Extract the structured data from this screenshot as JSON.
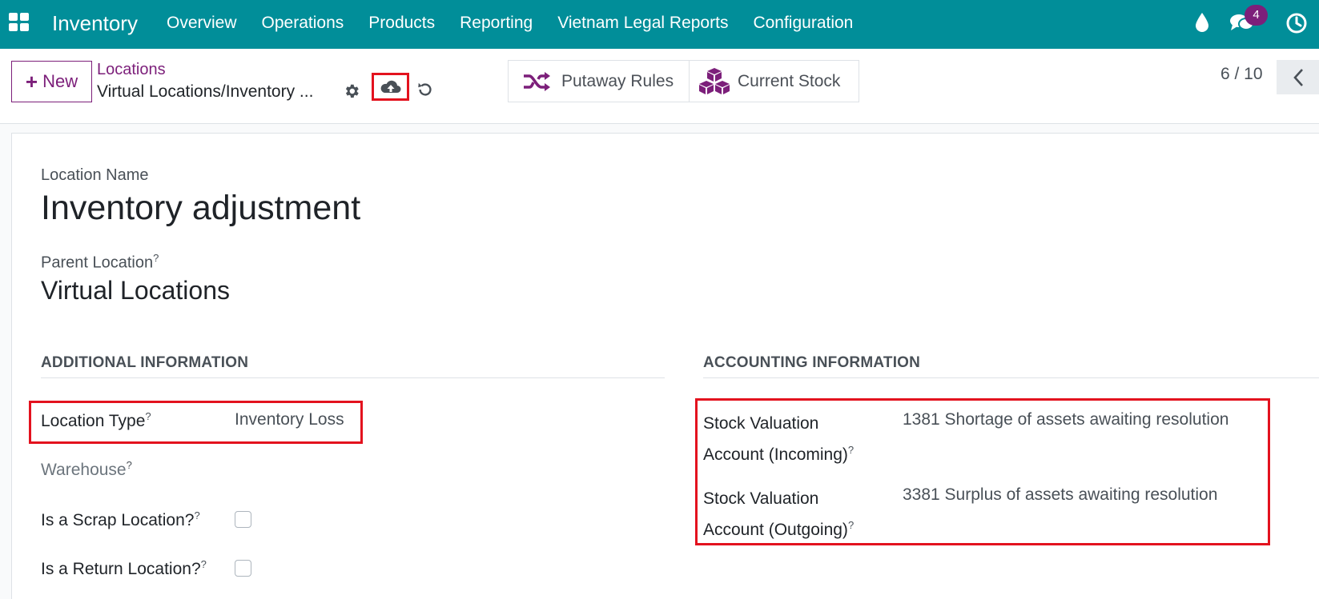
{
  "navbar": {
    "app_name": "Inventory",
    "menu": [
      "Overview",
      "Operations",
      "Products",
      "Reporting",
      "Vietnam Legal Reports",
      "Configuration"
    ],
    "messages_badge": "4",
    "bg_color": "#018e99"
  },
  "control": {
    "new_label": "New",
    "breadcrumb_parent": "Locations",
    "breadcrumb_current": "Virtual Locations/Inventory ...",
    "putaway_label": "Putaway Rules",
    "stock_label": "Current Stock",
    "pager": "6 / 10"
  },
  "form": {
    "name_label": "Location Name",
    "name_value": "Inventory adjustment",
    "parent_label": "Parent Location",
    "parent_value": "Virtual Locations",
    "help_mark": "?",
    "additional": {
      "header": "ADDITIONAL INFORMATION",
      "location_type_label": "Location Type",
      "location_type_value": "Inventory Loss",
      "warehouse_label": "Warehouse",
      "scrap_label": "Is a Scrap Location?",
      "return_label": "Is a Return Location?",
      "scrap_checked": false,
      "return_checked": false
    },
    "accounting": {
      "header": "ACCOUNTING INFORMATION",
      "incoming_label_1": "Stock Valuation",
      "incoming_label_2": "Account (Incoming)",
      "incoming_value": "1381 Shortage of assets awaiting resolution",
      "outgoing_label_1": "Stock Valuation",
      "outgoing_label_2": "Account (Outgoing)",
      "outgoing_value": "3381 Surplus of assets awaiting resolution"
    }
  },
  "colors": {
    "accent": "#7c1f7a",
    "highlight": "#e3121e"
  }
}
